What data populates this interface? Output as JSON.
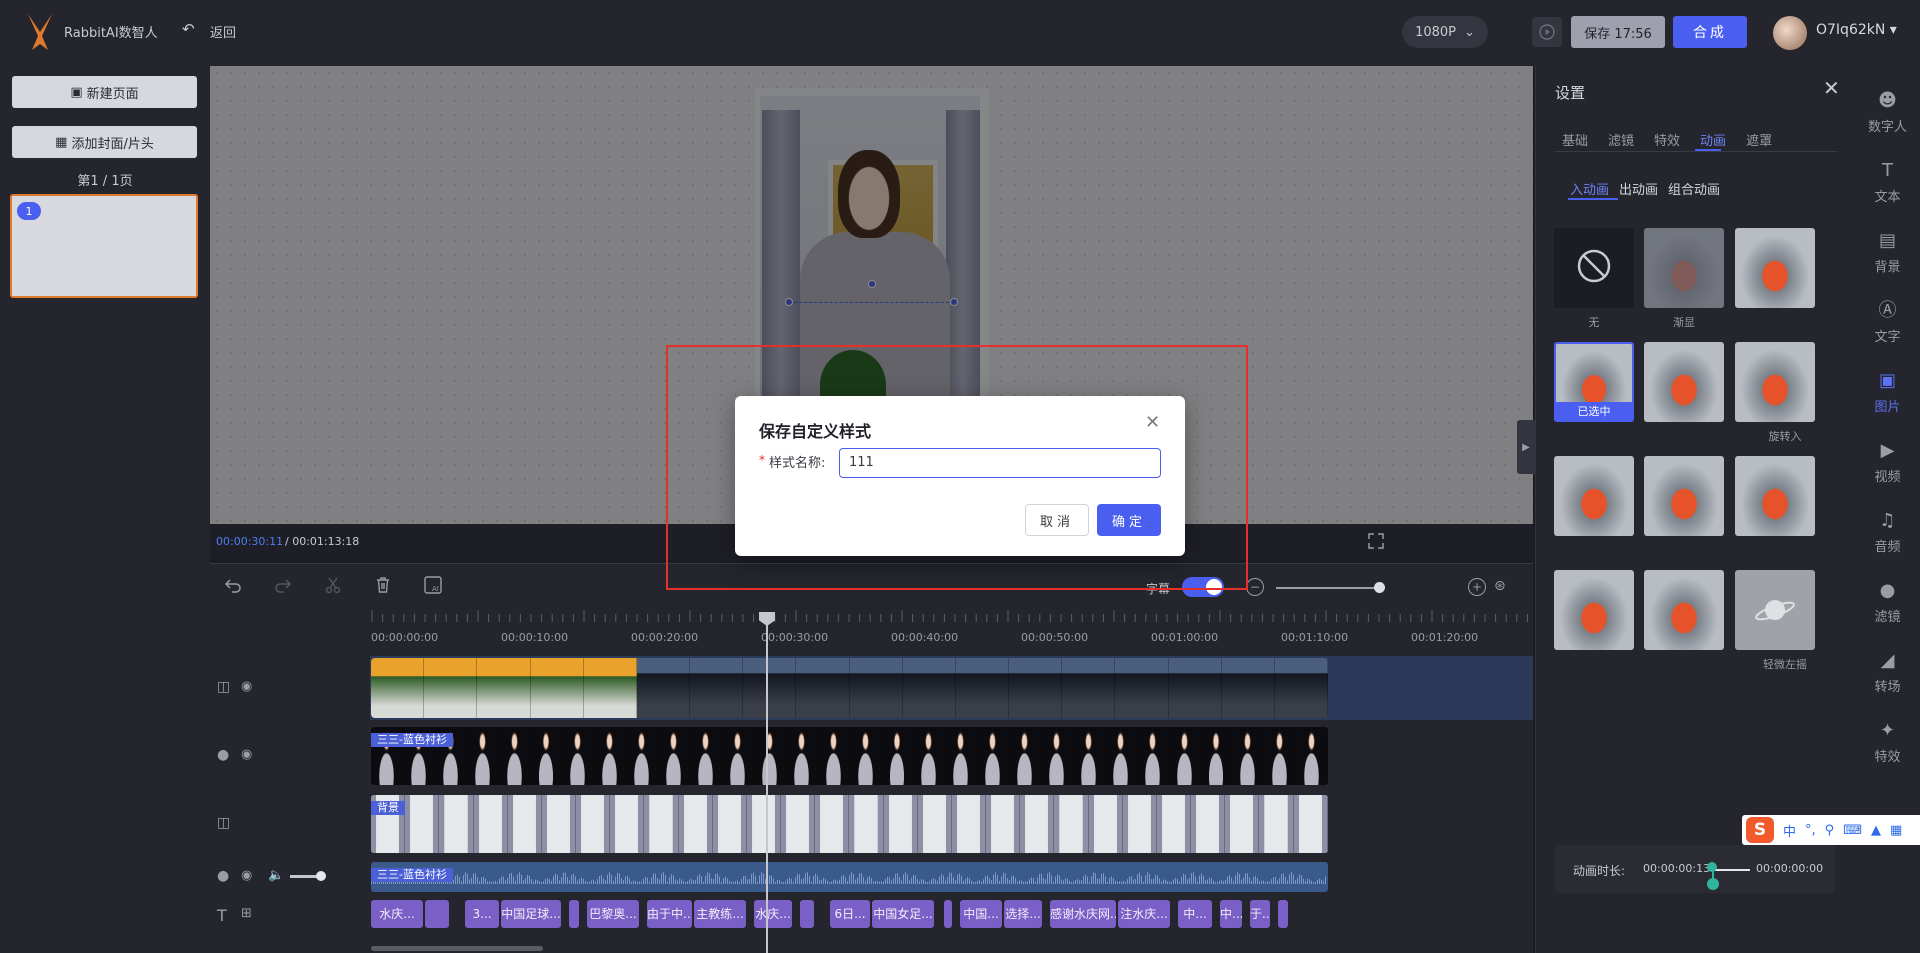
{
  "header": {
    "brand": "RabbitAI数智人",
    "back_label": "返回",
    "resolution": "1080P",
    "save_label": "保存 17:56",
    "merge_label": "合成",
    "username": "O7Iq62kN"
  },
  "left_panel": {
    "new_page": "新建页面",
    "add_cover": "添加封面/片头",
    "page_count": "第1 / 1页",
    "thumb_number": "1"
  },
  "player": {
    "current_time": "00:00:30:11",
    "total_time": "/ 00:01:13:18"
  },
  "timeline": {
    "subtitle_label": "字幕",
    "ruler_labels": [
      "00:00:00:00",
      "00:00:10:00",
      "00:00:20:00",
      "00:00:30:00",
      "00:00:40:00",
      "00:00:50:00",
      "00:01:00:00",
      "00:01:10:00",
      "00:01:20:00"
    ],
    "person_track_tag": "三三-蓝色衬衫",
    "bg_track_tag": "背景",
    "audio_track_tag": "三三-蓝色衬衫",
    "text_clips": [
      "水庆...",
      "",
      "3...",
      "中国足球...",
      "",
      "巴黎奥...",
      "由于中...",
      "主教练...",
      "水庆...",
      "",
      "6日...",
      "中国女足...",
      "",
      "中国...",
      "选择...",
      "感谢水庆网...",
      "注水庆...",
      "中...",
      "中...",
      "于...",
      ""
    ]
  },
  "settings": {
    "title": "设置",
    "tabs": [
      "基础",
      "滤镜",
      "特效",
      "动画",
      "遮罩"
    ],
    "active_tab": "动画",
    "sub_tabs": [
      "入动画",
      "出动画",
      "组合动画"
    ],
    "active_sub_tab": "入动画",
    "animations": [
      {
        "label": "无"
      },
      {
        "label": "渐显"
      },
      {
        "label": ""
      },
      {
        "label": "",
        "badge": "已选中"
      },
      {
        "label": ""
      },
      {
        "label": "旋转入"
      },
      {
        "label": ""
      },
      {
        "label": ""
      },
      {
        "label": ""
      },
      {
        "label": ""
      },
      {
        "label": ""
      },
      {
        "label": "轻微左摇"
      }
    ],
    "duration_label": "动画时长:",
    "duration_start": "00:00:00:13",
    "duration_end": "00:00:00:00"
  },
  "right_nav": [
    {
      "label": "数字人",
      "icon": "digital-human-icon"
    },
    {
      "label": "文本",
      "icon": "text-icon"
    },
    {
      "label": "背景",
      "icon": "background-icon"
    },
    {
      "label": "文字",
      "icon": "font-icon"
    },
    {
      "label": "图片",
      "icon": "image-icon",
      "active": true
    },
    {
      "label": "视频",
      "icon": "video-icon"
    },
    {
      "label": "音频",
      "icon": "audio-icon"
    },
    {
      "label": "滤镜",
      "icon": "filter-icon"
    },
    {
      "label": "转场",
      "icon": "transition-icon"
    },
    {
      "label": "特效",
      "icon": "effects-icon"
    }
  ],
  "ime_bar": {
    "mode": "中"
  },
  "dialog": {
    "title": "保存自定义样式",
    "required_mark": "*",
    "field_label": "样式名称:",
    "field_value": "111",
    "cancel_label": "取消",
    "ok_label": "确定"
  },
  "colors": {
    "accent": "#4a5ff0",
    "highlight_box": "#e3302a",
    "selection_border": "#e07a2c"
  }
}
